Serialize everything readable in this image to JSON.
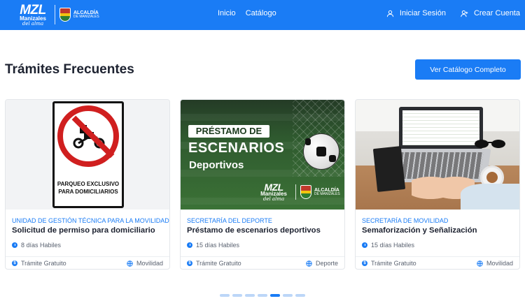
{
  "navbar": {
    "logo": {
      "mzl": "MZL",
      "city": "Manizales",
      "tagline": "del alma"
    },
    "alcaldia": {
      "line1": "ALCALDÍA",
      "line2": "DE MANIZALES"
    },
    "links": [
      "Inicio",
      "Catálogo"
    ],
    "login_label": "Iniciar Sesión",
    "register_label": "Crear Cuenta"
  },
  "section": {
    "title": "Trámites Frecuentes",
    "catalog_button": "Ver Catálogo Completo"
  },
  "cards": [
    {
      "image": {
        "line1": "PARQUEO EXCLUSIVO",
        "line2": "PARA DOMICILIARIOS"
      },
      "department": "UNIDAD DE GESTIÓN TÉCNICA PARA LA MOVILIDAD",
      "title": "Solicitud de permiso para domiciliario",
      "time": "8 días Habiles",
      "cost": "Trámite Gratuito",
      "category": "Movilidad"
    },
    {
      "image": {
        "pre": "PRÉSTAMO DE",
        "big": "ESCENARIOS",
        "small": "Deportivos"
      },
      "department": "SECRETARÍA DEL DEPORTE",
      "title": "Préstamo de escenarios deportivos",
      "time": "15 días Habiles",
      "cost": "Trámite Gratuito",
      "category": "Deporte"
    },
    {
      "department": "SECRETARÍA DE MOVILIDAD",
      "title": "Semaforización y Señalización",
      "time": "15 días Habiles",
      "cost": "Trámite Gratuito",
      "category": "Movilidad"
    }
  ],
  "carousel": {
    "total": 7,
    "active": 4
  },
  "colors": {
    "primary": "#1a7cf5",
    "text": "#1d2230",
    "muted": "#5a6270"
  }
}
